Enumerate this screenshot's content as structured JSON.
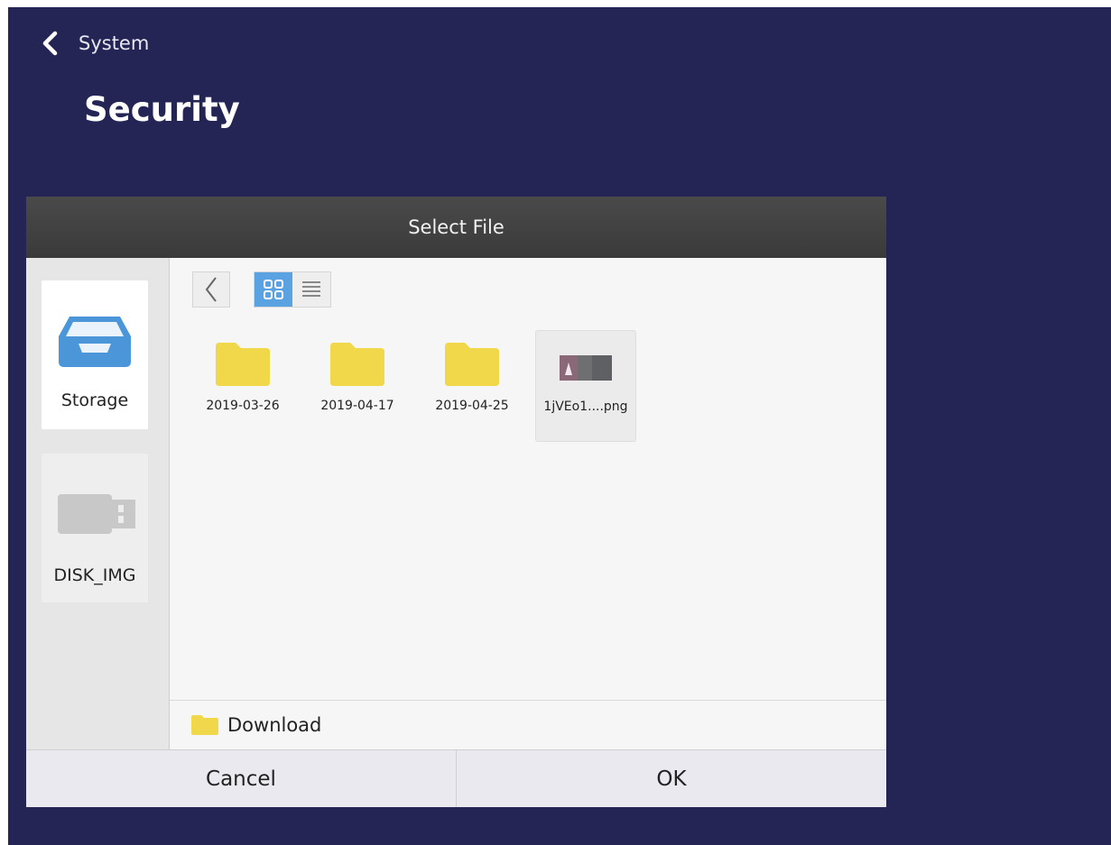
{
  "header": {
    "back_label": "System",
    "title": "Security"
  },
  "dialog": {
    "title": "Select File",
    "sources": [
      {
        "label": "Storage",
        "icon": "storage-tray-icon",
        "selected": true
      },
      {
        "label": "DISK_IMG",
        "icon": "usb-drive-icon",
        "selected": false
      }
    ],
    "toolbar": {
      "back_icon": "chevron-left-icon",
      "grid_icon": "grid-view-icon",
      "list_icon": "list-view-icon",
      "active_view": "grid"
    },
    "files": [
      {
        "name": "2019-03-26",
        "type": "folder"
      },
      {
        "name": "2019-04-17",
        "type": "folder"
      },
      {
        "name": "2019-04-25",
        "type": "folder"
      },
      {
        "name": "1jVEo1....png",
        "type": "image"
      }
    ],
    "current_path": "Download",
    "cancel_label": "Cancel",
    "ok_label": "OK"
  },
  "colors": {
    "background": "#242555",
    "accent": "#5ba2e2",
    "folder": "#f0d84a",
    "header": "#444444"
  }
}
